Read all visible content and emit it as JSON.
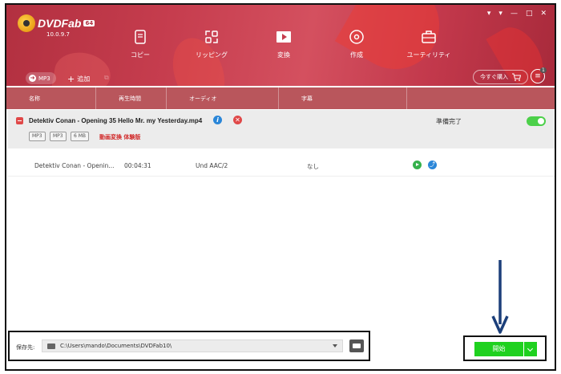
{
  "app": {
    "logo_text": "DVDFab",
    "logo_badge": "64",
    "version": "10.0.9.7",
    "window_controls": [
      "▾",
      "▾",
      "—",
      "□",
      "✕"
    ]
  },
  "nav": [
    {
      "label": "コピー",
      "icon": "copy-icon"
    },
    {
      "label": "リッピング",
      "icon": "ripper-icon"
    },
    {
      "label": "変換",
      "icon": "converter-icon"
    },
    {
      "label": "作成",
      "icon": "creator-icon"
    },
    {
      "label": "ユーティリティ",
      "icon": "utility-icon"
    }
  ],
  "toolbar": {
    "profile_label": "MP3",
    "add_label": "追加",
    "buy_label": "今すぐ購入",
    "queue_count": "1"
  },
  "columns": [
    "名称",
    "再生時間",
    "オーディオ",
    "字幕"
  ],
  "file": {
    "name": "Detektiv Conan - Opening 35 Hello Mr. my Yesterday.mp4",
    "tags": [
      "MP3",
      "MP3",
      "6 MB"
    ],
    "convert_label": "動画変換 体験版",
    "status": "準備完了",
    "enabled": true
  },
  "track": {
    "name": "Detektiv Conan - Openin...",
    "duration": "00:04:31",
    "audio": "Und AAC/2",
    "subtitle": "なし"
  },
  "save": {
    "label": "保存先:",
    "path": "C:\\Users\\mando\\Documents\\DVDFab10\\"
  },
  "start": {
    "label": "開始"
  },
  "colors": {
    "header": "#c63d4e",
    "column_header": "#b9565c",
    "start_green": "#1fd11f",
    "annotation_arrow": "#1c3f7a"
  }
}
